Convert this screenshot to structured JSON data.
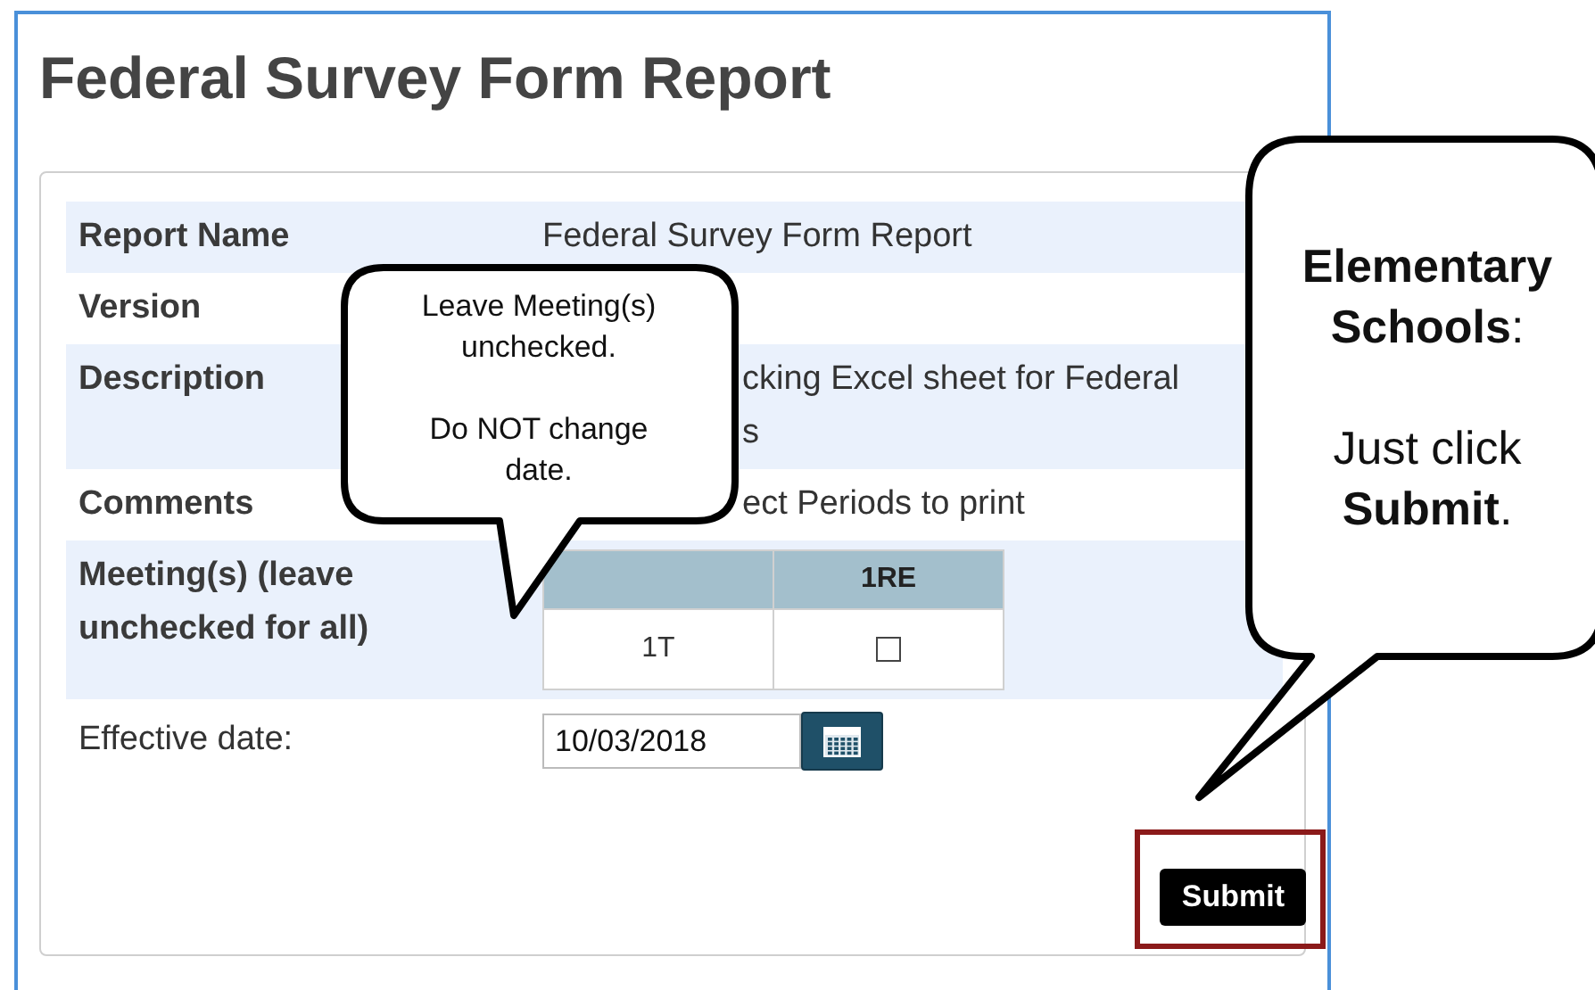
{
  "page_title": "Federal Survey Form Report",
  "fields": [
    {
      "kind": "text",
      "label": "Report Name",
      "value_lines": [
        "Federal Survey Form Report"
      ],
      "partial": false
    },
    {
      "kind": "text",
      "label": "Version",
      "partial": false
    },
    {
      "kind": "text",
      "label": "Description",
      "value_lines": [
        "cking Excel sheet for Federal",
        "s"
      ],
      "partial": true
    },
    {
      "kind": "text",
      "label": "Comments",
      "value_lines": [
        "ect Periods to print"
      ],
      "partial": true
    },
    {
      "kind": "meetings",
      "label": "Meeting(s) (leave unchecked for all)",
      "table": {
        "header": "1RE",
        "rows": [
          {
            "label": "1T",
            "checked": false
          }
        ]
      }
    },
    {
      "kind": "date",
      "label": "Effective date:",
      "value": "10/03/2018"
    }
  ],
  "submit_button": "Submit",
  "callouts": [
    {
      "kind": "left",
      "paragraphs": [
        "Leave Meeting(s) unchecked.",
        "Do NOT change date."
      ]
    },
    {
      "kind": "right",
      "paragraphs": [
        "**Elementary Schools**:",
        "Just click **Submit**."
      ]
    }
  ]
}
